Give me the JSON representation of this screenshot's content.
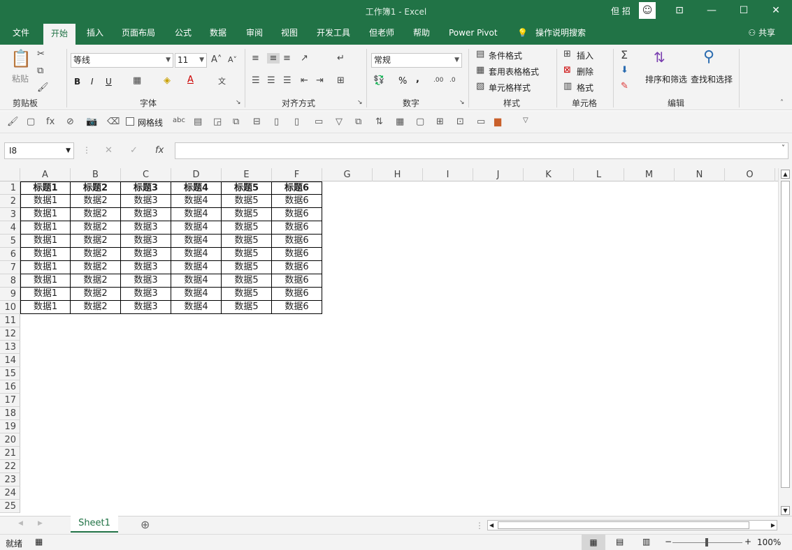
{
  "window": {
    "title": "工作簿1  -  Excel",
    "user": "但 招",
    "minimize": "—",
    "restore": "☐",
    "close": "✕",
    "ribbon_display": "⊡"
  },
  "tabs": [
    "文件",
    "开始",
    "插入",
    "页面布局",
    "公式",
    "数据",
    "审阅",
    "视图",
    "开发工具",
    "但老师",
    "帮助",
    "Power Pivot"
  ],
  "active_tab": "开始",
  "tell_me": "操作说明搜索",
  "share": "共享",
  "ribbon": {
    "clipboard": {
      "paste": "粘贴",
      "label": "剪贴板"
    },
    "font": {
      "name": "等线",
      "size": "11",
      "bold": "B",
      "italic": "I",
      "underline": "U",
      "label": "字体"
    },
    "alignment": {
      "label": "对齐方式"
    },
    "number": {
      "format": "常规",
      "percent": "%",
      "comma": ",",
      "label": "数字"
    },
    "styles": {
      "conditional": "条件格式",
      "table": "套用表格格式",
      "cell_styles": "单元格样式",
      "label": "样式"
    },
    "cells": {
      "insert": "插入",
      "delete": "删除",
      "format": "格式",
      "label": "单元格"
    },
    "editing": {
      "sort": "排序和筛选",
      "find": "查找和选择",
      "label": "编辑"
    }
  },
  "qat": {
    "gridlines": "网格线"
  },
  "formula_bar": {
    "name_box": "I8",
    "cancel": "✕",
    "enter": "✓",
    "fx": "fx",
    "content": ""
  },
  "columns": [
    "A",
    "B",
    "C",
    "D",
    "E",
    "F",
    "G",
    "H",
    "I",
    "J",
    "K",
    "L",
    "M",
    "N",
    "O"
  ],
  "rows": [
    "1",
    "2",
    "3",
    "4",
    "5",
    "6",
    "7",
    "8",
    "9",
    "10",
    "11",
    "12",
    "13",
    "14",
    "15",
    "16",
    "17",
    "18",
    "19",
    "20",
    "21",
    "22",
    "23",
    "24",
    "25"
  ],
  "table": {
    "headers": [
      "标题1",
      "标题2",
      "标题3",
      "标题4",
      "标题5",
      "标题6"
    ],
    "rows": [
      [
        "数据1",
        "数据2",
        "数据3",
        "数据4",
        "数据5",
        "数据6"
      ],
      [
        "数据1",
        "数据2",
        "数据3",
        "数据4",
        "数据5",
        "数据6"
      ],
      [
        "数据1",
        "数据2",
        "数据3",
        "数据4",
        "数据5",
        "数据6"
      ],
      [
        "数据1",
        "数据2",
        "数据3",
        "数据4",
        "数据5",
        "数据6"
      ],
      [
        "数据1",
        "数据2",
        "数据3",
        "数据4",
        "数据5",
        "数据6"
      ],
      [
        "数据1",
        "数据2",
        "数据3",
        "数据4",
        "数据5",
        "数据6"
      ],
      [
        "数据1",
        "数据2",
        "数据3",
        "数据4",
        "数据5",
        "数据6"
      ],
      [
        "数据1",
        "数据2",
        "数据3",
        "数据4",
        "数据5",
        "数据6"
      ],
      [
        "数据1",
        "数据2",
        "数据3",
        "数据4",
        "数据5",
        "数据6"
      ]
    ]
  },
  "sheet_tab": "Sheet1",
  "add_sheet": "⊕",
  "status": {
    "ready": "就绪",
    "zoom": "100%",
    "minus": "−",
    "plus": "+"
  },
  "colors": {
    "accent": "#217346",
    "ribbon_bg": "#f3f3f3"
  }
}
